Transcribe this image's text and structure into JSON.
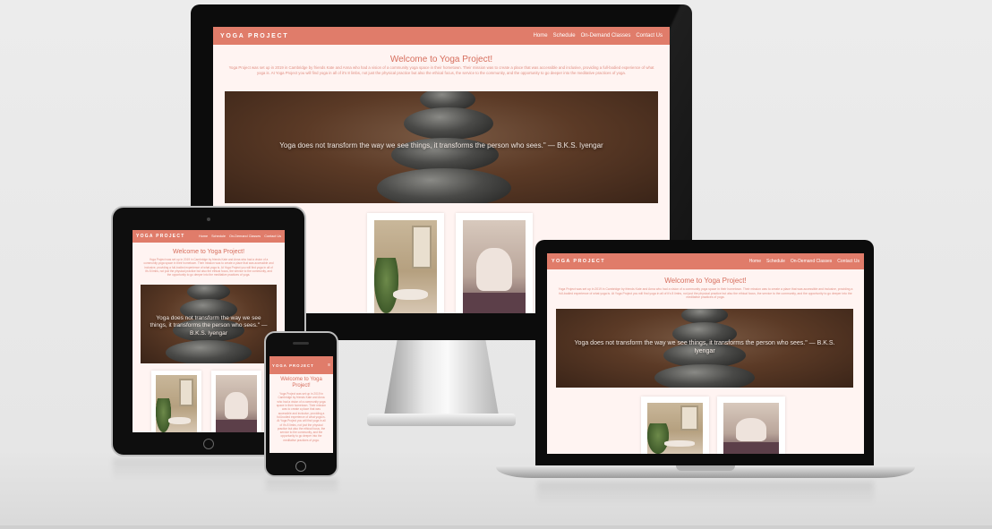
{
  "site": {
    "brand": "YOGA PROJECT",
    "nav": [
      "Home",
      "Schedule",
      "On-Demand Classes",
      "Contact Us"
    ],
    "welcome": "Welcome to Yoga Project!",
    "intro": "Yoga Project was set up in 2019 in Cambridge by friends Kate and Anna who had a vision of a community yoga space in their hometown. Their mission was to create a place that was accessible and inclusive, providing a full-bodied experience of what yoga is. At Yoga Project you will find yoga in all of it's 8 limbs, not just the physical practice but also the ethical focus, the service to the community, and the opportunity to go deeper into the meditative practices of yoga.",
    "quote": "Yoga does not transform the way we see things, it transforms the person who sees.\" — B.K.S. Iyengar"
  },
  "colors": {
    "accent": "#e07c6a",
    "page_bg": "#fff4f2",
    "heading": "#d66e5d"
  },
  "devices": [
    "desktop-monitor",
    "tablet",
    "phone",
    "laptop"
  ]
}
